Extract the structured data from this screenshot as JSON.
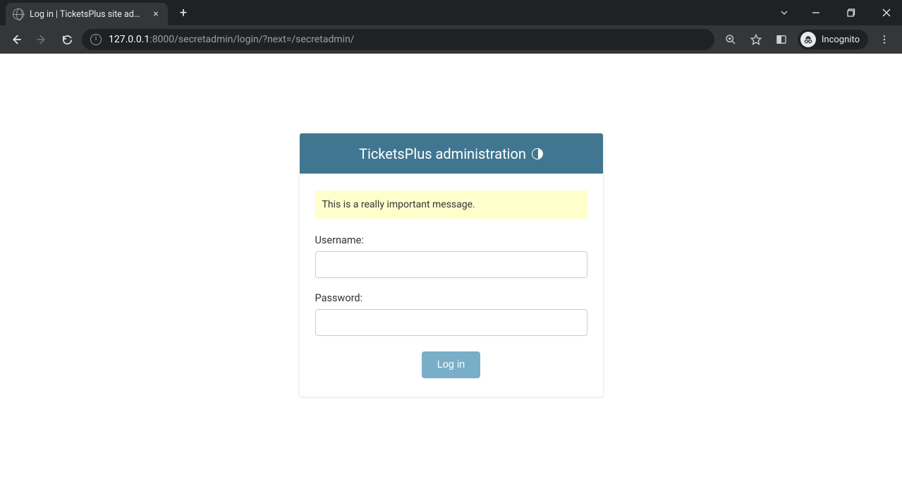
{
  "browser": {
    "tab_title": "Log in | TicketsPlus site admin",
    "url_host": "127.0.0.1",
    "url_port_path": ":8000/secretadmin/login/?next=/secretadmin/",
    "incognito_label": "Incognito"
  },
  "page": {
    "header_title": "TicketsPlus administration",
    "message": "This is a really important message.",
    "username_label": "Username:",
    "password_label": "Password:",
    "submit_label": "Log in",
    "username_value": "",
    "password_value": ""
  }
}
